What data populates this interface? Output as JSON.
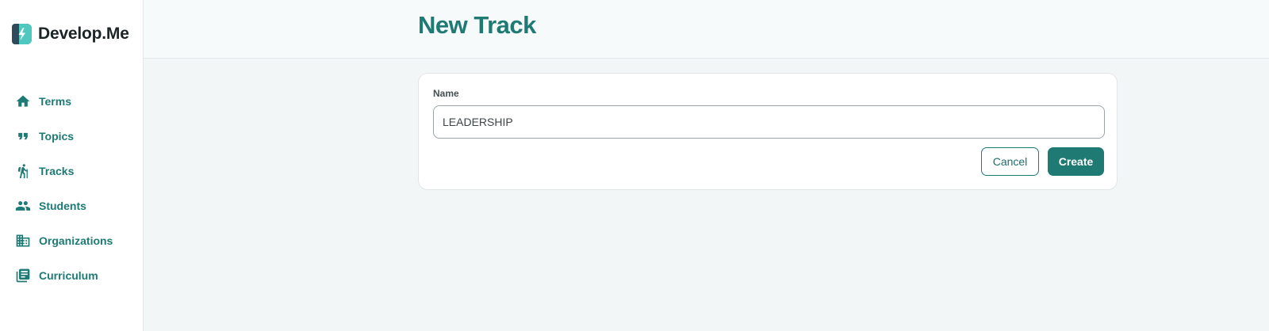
{
  "brand": {
    "name": "Develop.Me",
    "logo_icon": "lightning-bolt-logo"
  },
  "sidebar": {
    "items": [
      {
        "label": "Terms",
        "icon": "home-icon"
      },
      {
        "label": "Topics",
        "icon": "quote-icon"
      },
      {
        "label": "Tracks",
        "icon": "hiker-icon"
      },
      {
        "label": "Students",
        "icon": "people-icon"
      },
      {
        "label": "Organizations",
        "icon": "building-icon"
      },
      {
        "label": "Curriculum",
        "icon": "library-books-icon"
      }
    ]
  },
  "header": {
    "title": "New Track"
  },
  "form": {
    "name_label": "Name",
    "name_value": "LEADERSHIP",
    "cancel_label": "Cancel",
    "create_label": "Create"
  },
  "colors": {
    "accent": "#1f7a74",
    "page_bg": "#f3f6f7",
    "sidebar_bg": "#ffffff"
  }
}
